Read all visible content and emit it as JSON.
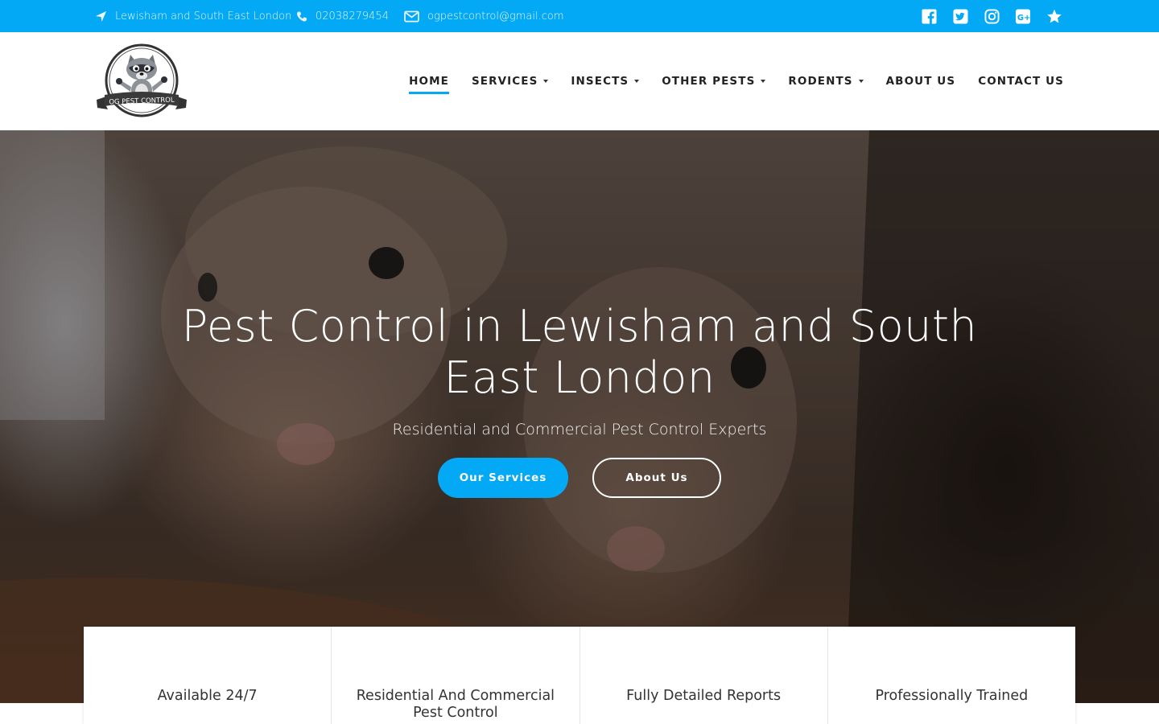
{
  "topbar": {
    "location": "Lewisham and South East London",
    "phone": "02038279454",
    "email": "ogpestcontrol@gmail.com",
    "social": [
      "facebook-icon",
      "twitter-icon",
      "instagram-icon",
      "google-plus-icon",
      "star-icon"
    ]
  },
  "logo": {
    "text": "OG PEST CONTROL"
  },
  "nav": {
    "items": [
      {
        "label": "HOME",
        "active": true,
        "dropdown": false
      },
      {
        "label": "SERVICES",
        "dropdown": true
      },
      {
        "label": "INSECTS",
        "dropdown": true
      },
      {
        "label": "OTHER PESTS",
        "dropdown": true
      },
      {
        "label": "RODENTS",
        "dropdown": true
      },
      {
        "label": "ABOUT US",
        "dropdown": false
      },
      {
        "label": "CONTACT US",
        "dropdown": false
      }
    ]
  },
  "hero": {
    "title": "Pest Control in Lewisham and South East London",
    "subtitle": "Residential and Commercial Pest Control Experts",
    "primary_button": "Our Services",
    "secondary_button": "About Us"
  },
  "features": [
    {
      "title": "Available 24/7"
    },
    {
      "title": "Residential And Commercial Pest Control"
    },
    {
      "title": "Fully Detailed Reports"
    },
    {
      "title": "Professionally Trained"
    }
  ],
  "colors": {
    "accent": "#03a9f4"
  }
}
